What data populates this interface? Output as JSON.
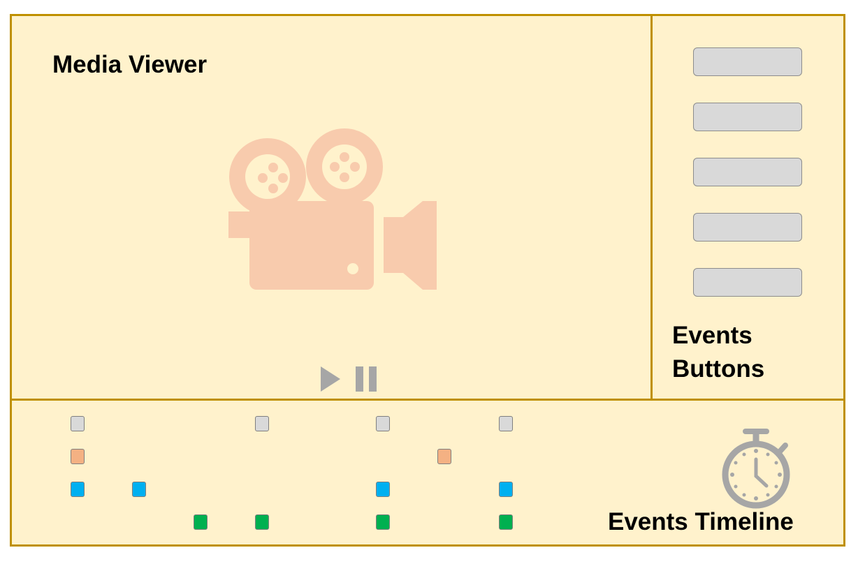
{
  "media_viewer": {
    "title": "Media Viewer",
    "camera_icon": "video-camera-icon",
    "controls": {
      "play_icon": "play-icon",
      "pause_icon": "pause-icon"
    }
  },
  "events_buttons": {
    "title": "Events Buttons",
    "buttons": [
      {
        "label": ""
      },
      {
        "label": ""
      },
      {
        "label": ""
      },
      {
        "label": ""
      },
      {
        "label": ""
      }
    ]
  },
  "events_timeline": {
    "title": "Events Timeline",
    "icon": "stopwatch-icon",
    "colors": {
      "gray": "#d9d9d9",
      "orange": "#f4b183",
      "blue": "#00b0f0",
      "green": "#00b050"
    }
  },
  "colors": {
    "panel_fill": "#fff2cc",
    "panel_border": "#bf9000",
    "camera": "#f8cbad",
    "controls": "#a6a6a6"
  }
}
